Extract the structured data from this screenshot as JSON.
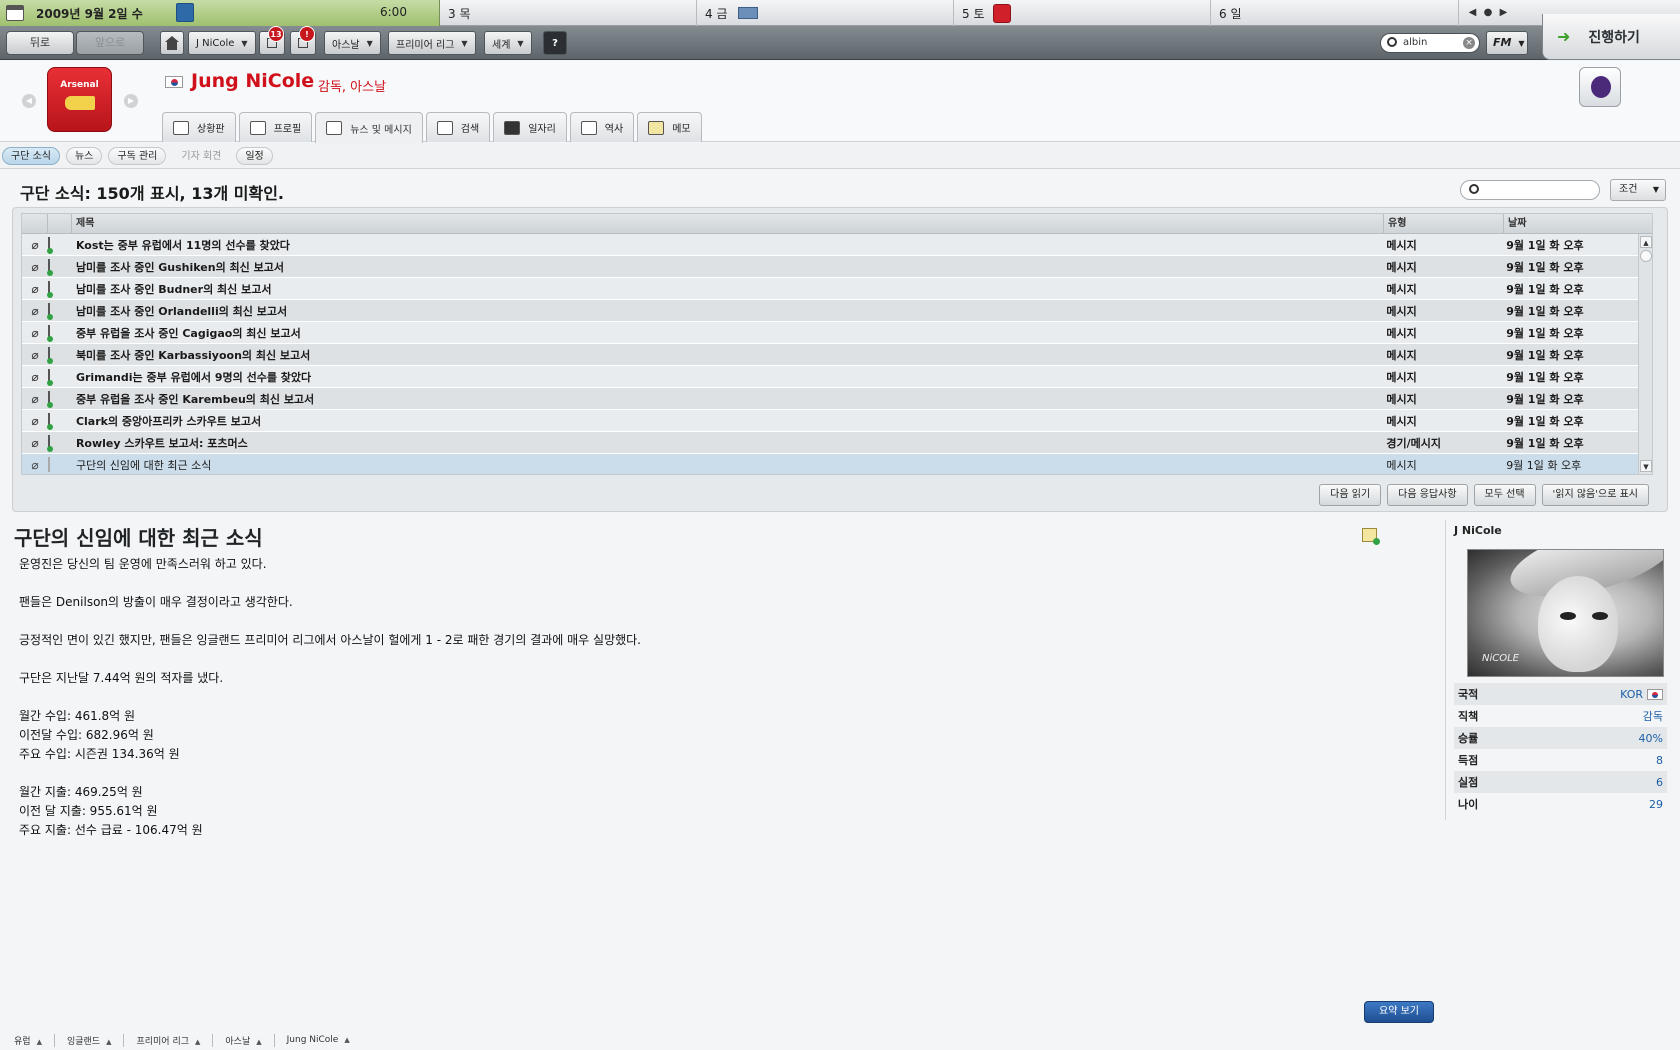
{
  "calendar": {
    "today_date": "2009년 9월 2일 수",
    "today_time": "6:00",
    "days": [
      "3 목",
      "4 금",
      "5 토",
      "6 일"
    ]
  },
  "toolbar": {
    "back_label": "뒤로",
    "forward_label": "앞으로",
    "manager_menu": "J NiCole",
    "inbox_badge": "13",
    "alert_badge": "!",
    "menus": [
      "아스날",
      "프리미어 리그",
      "세계"
    ],
    "help_label": "?",
    "search_value": "albin",
    "fm_label": "FM",
    "continue_label": "진행하기"
  },
  "header": {
    "manager_name": "Jung NiCole",
    "manager_role": "감독, 아스날",
    "crest_text": "Arsenal",
    "tabs": [
      "상황판",
      "프로필",
      "뉴스 및 메시지",
      "검색",
      "일자리",
      "역사",
      "메모"
    ],
    "active_tab": 2
  },
  "subtabs": {
    "items": [
      "구단 소식",
      "뉴스",
      "구독 관리",
      "기자 회견",
      "일정"
    ]
  },
  "inbox": {
    "title": "구단 소식: 150개 표시, 13개 미확인.",
    "filter_label": "조건",
    "columns": {
      "subject": "제목",
      "type": "유형",
      "date": "날짜"
    },
    "rows": [
      {
        "subject": "Kost는 중부 유럽에서 11명의 선수를 찾았다",
        "type": "메시지",
        "date": "9월 1일 화 오후"
      },
      {
        "subject": "남미를 조사 중인 Gushiken의 최신 보고서",
        "type": "메시지",
        "date": "9월 1일 화 오후"
      },
      {
        "subject": "남미를 조사 중인 Budner의 최신 보고서",
        "type": "메시지",
        "date": "9월 1일 화 오후"
      },
      {
        "subject": "남미를 조사 중인 Orlandelli의 최신 보고서",
        "type": "메시지",
        "date": "9월 1일 화 오후"
      },
      {
        "subject": "중부 유럽을 조사 중인 Cagigao의 최신 보고서",
        "type": "메시지",
        "date": "9월 1일 화 오후"
      },
      {
        "subject": "북미를 조사 중인 Karbassiyoon의 최신 보고서",
        "type": "메시지",
        "date": "9월 1일 화 오후"
      },
      {
        "subject": "Grimandi는 중부 유럽에서 9명의 선수를 찾았다",
        "type": "메시지",
        "date": "9월 1일 화 오후"
      },
      {
        "subject": "중부 유럽을 조사 중인 Karembeu의 최신 보고서",
        "type": "메시지",
        "date": "9월 1일 화 오후"
      },
      {
        "subject": "Clark의 중앙아프리카 스카우트 보고서",
        "type": "메시지",
        "date": "9월 1일 화 오후"
      },
      {
        "subject": "Rowley 스카우트 보고서: 포츠머스",
        "type": "경기/메시지",
        "date": "9월 1일 화 오후"
      },
      {
        "subject": "구단의 신임에 대한 최근 소식",
        "type": "메시지",
        "date": "9월 1일 화 오후"
      }
    ],
    "actions": [
      "다음 읽기",
      "다음 응답사항",
      "모두 선택",
      "'읽지 않음'으로 표시"
    ]
  },
  "message": {
    "title": "구단의 신임에 대한 최근 소식",
    "lines": [
      "운영진은 당신의 팀 운영에 만족스러워 하고 있다.",
      "",
      "팬들은 Denilson의 방출이 매우 결정이라고 생각한다.",
      "",
      "긍정적인 면이 있긴 했지만, 팬들은 잉글랜드 프리미어 리그에서 아스날이 헐에게 1 - 2로 패한 경기의 결과에 매우 실망했다.",
      "",
      "구단은 지난달 7.44억 원의 적자를 냈다.",
      "",
      "월간 수입: 461.8억 원",
      "이전달 수입: 682.96억 원",
      "주요 수입: 시즌권 134.36억 원",
      "",
      "월간 지출: 469.25억 원",
      "이전 달 지출: 955.61억 원",
      "주요 지출: 선수 급료 - 106.47억 원"
    ]
  },
  "profile": {
    "name": "J NiCole",
    "photo_signature": "NiCOLE",
    "stats": [
      {
        "label": "국적",
        "value": "KOR"
      },
      {
        "label": "직책",
        "value": "감독"
      },
      {
        "label": "승률",
        "value": "40%"
      },
      {
        "label": "득점",
        "value": "8"
      },
      {
        "label": "실점",
        "value": "6"
      },
      {
        "label": "나이",
        "value": "29"
      }
    ]
  },
  "footer": {
    "summary_label": "요약 보기",
    "breadcrumb": [
      "유럽",
      "잉글랜드",
      "프리미어 리그",
      "아스날",
      "Jung NiCole"
    ]
  }
}
